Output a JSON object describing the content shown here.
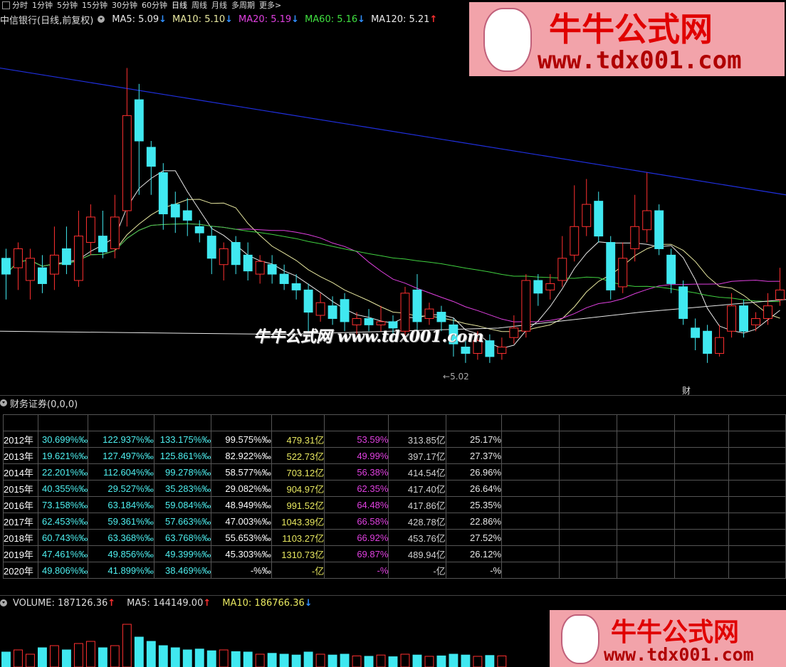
{
  "toolbar": {
    "tabs": [
      "分时",
      "1分钟",
      "5分钟",
      "15分钟",
      "30分钟",
      "60分钟",
      "日线",
      "周线",
      "月线",
      "多周期",
      "更多>"
    ],
    "active": "日线"
  },
  "header": {
    "title": "中信银行(日线,前复权)",
    "ma": [
      {
        "label": "MA5: 5.09",
        "dir": "down",
        "color": "#e8e8e8"
      },
      {
        "label": "MA10: 5.10",
        "dir": "down",
        "color": "#e8e8a0"
      },
      {
        "label": "MA20: 5.19",
        "dir": "down",
        "color": "#e040e0"
      },
      {
        "label": "MA60: 5.16",
        "dir": "down",
        "color": "#40e040"
      },
      {
        "label": "MA120: 5.21",
        "dir": "up",
        "color": "#e8e8e8"
      }
    ]
  },
  "chart_data": {
    "type": "candlestick",
    "candles": [
      {
        "o": 5.35,
        "c": 5.3,
        "h": 5.38,
        "l": 5.22
      },
      {
        "o": 5.32,
        "c": 5.38,
        "h": 5.4,
        "l": 5.25
      },
      {
        "o": 5.28,
        "c": 5.35,
        "h": 5.38,
        "l": 5.22
      },
      {
        "o": 5.32,
        "c": 5.27,
        "h": 5.36,
        "l": 5.24
      },
      {
        "o": 5.3,
        "c": 5.36,
        "h": 5.45,
        "l": 5.25
      },
      {
        "o": 5.38,
        "c": 5.33,
        "h": 5.45,
        "l": 5.3
      },
      {
        "o": 5.28,
        "c": 5.42,
        "h": 5.5,
        "l": 5.26
      },
      {
        "o": 5.4,
        "c": 5.48,
        "h": 5.52,
        "l": 5.36
      },
      {
        "o": 5.42,
        "c": 5.37,
        "h": 5.5,
        "l": 5.35
      },
      {
        "o": 5.38,
        "c": 5.48,
        "h": 5.55,
        "l": 5.35
      },
      {
        "o": 5.5,
        "c": 5.8,
        "h": 5.95,
        "l": 5.45
      },
      {
        "o": 5.85,
        "c": 5.72,
        "h": 5.9,
        "l": 5.55
      },
      {
        "o": 5.7,
        "c": 5.64,
        "h": 5.72,
        "l": 5.55
      },
      {
        "o": 5.62,
        "c": 5.49,
        "h": 5.65,
        "l": 5.44
      },
      {
        "o": 5.52,
        "c": 5.48,
        "h": 5.56,
        "l": 5.43
      },
      {
        "o": 5.5,
        "c": 5.47,
        "h": 5.54,
        "l": 5.42
      },
      {
        "o": 5.45,
        "c": 5.43,
        "h": 5.47,
        "l": 5.4
      },
      {
        "o": 5.42,
        "c": 5.35,
        "h": 5.45,
        "l": 5.3
      },
      {
        "o": 5.33,
        "c": 5.38,
        "h": 5.4,
        "l": 5.28
      },
      {
        "o": 5.4,
        "c": 5.33,
        "h": 5.42,
        "l": 5.3
      },
      {
        "o": 5.36,
        "c": 5.31,
        "h": 5.4,
        "l": 5.28
      },
      {
        "o": 5.3,
        "c": 5.34,
        "h": 5.36,
        "l": 5.27
      },
      {
        "o": 5.33,
        "c": 5.3,
        "h": 5.36,
        "l": 5.27
      },
      {
        "o": 5.3,
        "c": 5.27,
        "h": 5.33,
        "l": 5.25
      },
      {
        "o": 5.27,
        "c": 5.25,
        "h": 5.3,
        "l": 5.22
      },
      {
        "o": 5.25,
        "c": 5.18,
        "h": 5.27,
        "l": 5.12
      },
      {
        "o": 5.17,
        "c": 5.21,
        "h": 5.24,
        "l": 5.15
      },
      {
        "o": 5.2,
        "c": 5.16,
        "h": 5.23,
        "l": 5.14
      },
      {
        "o": 5.22,
        "c": 5.15,
        "h": 5.24,
        "l": 5.12
      },
      {
        "o": 5.14,
        "c": 5.16,
        "h": 5.18,
        "l": 5.11
      },
      {
        "o": 5.16,
        "c": 5.14,
        "h": 5.19,
        "l": 5.12
      },
      {
        "o": 5.14,
        "c": 5.15,
        "h": 5.2,
        "l": 5.12
      },
      {
        "o": 5.15,
        "c": 5.13,
        "h": 5.17,
        "l": 5.1
      },
      {
        "o": 5.12,
        "c": 5.24,
        "h": 5.26,
        "l": 5.1
      },
      {
        "o": 5.25,
        "c": 5.15,
        "h": 5.3,
        "l": 5.12
      },
      {
        "o": 5.16,
        "c": 5.19,
        "h": 5.21,
        "l": 5.14
      },
      {
        "o": 5.18,
        "c": 5.15,
        "h": 5.2,
        "l": 5.12
      },
      {
        "o": 5.14,
        "c": 5.08,
        "h": 5.16,
        "l": 5.04
      },
      {
        "o": 5.07,
        "c": 5.05,
        "h": 5.1,
        "l": 5.02
      },
      {
        "o": 5.05,
        "c": 5.09,
        "h": 5.12,
        "l": 5.03
      },
      {
        "o": 5.09,
        "c": 5.04,
        "h": 5.11,
        "l": 5.02
      },
      {
        "o": 5.05,
        "c": 5.07,
        "h": 5.1,
        "l": 5.03
      },
      {
        "o": 5.1,
        "c": 5.13,
        "h": 5.17,
        "l": 5.08
      },
      {
        "o": 5.12,
        "c": 5.28,
        "h": 5.3,
        "l": 5.1
      },
      {
        "o": 5.28,
        "c": 5.24,
        "h": 5.3,
        "l": 5.2
      },
      {
        "o": 5.25,
        "c": 5.27,
        "h": 5.3,
        "l": 5.22
      },
      {
        "o": 5.28,
        "c": 5.35,
        "h": 5.42,
        "l": 5.26
      },
      {
        "o": 5.36,
        "c": 5.45,
        "h": 5.58,
        "l": 5.34
      },
      {
        "o": 5.45,
        "c": 5.52,
        "h": 5.6,
        "l": 5.42
      },
      {
        "o": 5.53,
        "c": 5.42,
        "h": 5.56,
        "l": 5.4
      },
      {
        "o": 5.4,
        "c": 5.25,
        "h": 5.42,
        "l": 5.22
      },
      {
        "o": 5.26,
        "c": 5.35,
        "h": 5.4,
        "l": 5.24
      },
      {
        "o": 5.38,
        "c": 5.45,
        "h": 5.55,
        "l": 5.34
      },
      {
        "o": 5.44,
        "c": 5.5,
        "h": 5.62,
        "l": 5.4
      },
      {
        "o": 5.5,
        "c": 5.38,
        "h": 5.52,
        "l": 5.36
      },
      {
        "o": 5.36,
        "c": 5.27,
        "h": 5.38,
        "l": 5.24
      },
      {
        "o": 5.26,
        "c": 5.16,
        "h": 5.28,
        "l": 5.14
      },
      {
        "o": 5.13,
        "c": 5.1,
        "h": 5.16,
        "l": 5.06
      },
      {
        "o": 5.12,
        "c": 5.05,
        "h": 5.14,
        "l": 5.02
      },
      {
        "o": 5.05,
        "c": 5.1,
        "h": 5.14,
        "l": 5.04
      },
      {
        "o": 5.12,
        "c": 5.2,
        "h": 5.24,
        "l": 5.1
      },
      {
        "o": 5.2,
        "c": 5.12,
        "h": 5.22,
        "l": 5.1
      },
      {
        "o": 5.14,
        "c": 5.16,
        "h": 5.18,
        "l": 5.12
      },
      {
        "o": 5.16,
        "c": 5.2,
        "h": 5.24,
        "l": 5.14
      },
      {
        "o": 5.22,
        "c": 5.25,
        "h": 5.32,
        "l": 5.2
      }
    ],
    "low_label": "5.02",
    "event_label": "财"
  },
  "fin": {
    "title": "财务证券(0,0,0)",
    "rows": [
      [
        "2012年",
        "30.699%‰",
        "122.937%‰",
        "133.175%‰",
        "99.575%‰",
        "479.31亿",
        "53.59%",
        "313.85亿",
        "25.17%"
      ],
      [
        "2013年",
        "19.621%‰",
        "127.497%‰",
        "125.861%‰",
        "82.922%‰",
        "522.73亿",
        "49.99%",
        "397.17亿",
        "27.37%"
      ],
      [
        "2014年",
        "22.201%‰",
        "112.604%‰",
        "99.278%‰",
        "58.577%‰",
        "703.12亿",
        "56.38%",
        "414.54亿",
        "26.96%"
      ],
      [
        "2015年",
        "40.355%‰",
        "29.527%‰",
        "35.283%‰",
        "29.082%‰",
        "904.97亿",
        "62.35%",
        "417.40亿",
        "26.64%"
      ],
      [
        "2016年",
        "73.158%‰",
        "63.184%‰",
        "59.084%‰",
        "48.949%‰",
        "991.52亿",
        "64.48%",
        "417.86亿",
        "25.35%"
      ],
      [
        "2017年",
        "62.453%‰",
        "59.361%‰",
        "57.663%‰",
        "47.003%‰",
        "1043.39亿",
        "66.58%",
        "428.78亿",
        "22.86%"
      ],
      [
        "2018年",
        "60.743%‰",
        "63.368%‰",
        "63.768%‰",
        "55.653%‰",
        "1103.27亿",
        "66.92%",
        "453.76亿",
        "27.52%"
      ],
      [
        "2019年",
        "47.461%‰",
        "49.856%‰",
        "49.399%‰",
        "45.303%‰",
        "1310.73亿",
        "69.87%",
        "489.94亿",
        "26.12%"
      ],
      [
        "2020年",
        "49.806%‰",
        "41.899%‰",
        "38.469%‰",
        "-%‰",
        "-亿",
        "-%",
        "-亿",
        "-%"
      ]
    ],
    "colors": [
      "#ffffff",
      "#4ef0f0",
      "#4ef0f0",
      "#4ef0f0",
      "#ffffff",
      "#e8e860",
      "#e040e0",
      "#d0d0d0",
      "#e8e8e8"
    ]
  },
  "volume": {
    "label": "VOLUME: 187126.36",
    "ma5": "MA5: 144149.00",
    "ma10": "MA10: 186766.36",
    "bars": [
      0.35,
      0.4,
      0.3,
      0.45,
      0.5,
      0.4,
      0.55,
      0.6,
      0.45,
      0.5,
      1.0,
      0.7,
      0.6,
      0.5,
      0.45,
      0.4,
      0.42,
      0.38,
      0.4,
      0.36,
      0.35,
      0.3,
      0.32,
      0.3,
      0.28,
      0.35,
      0.3,
      0.28,
      0.3,
      0.26,
      0.25,
      0.28,
      0.24,
      0.3,
      0.28,
      0.25,
      0.26,
      0.3,
      0.28,
      0.25,
      0.27,
      0.26
    ]
  },
  "watermarks": {
    "brand": "牛牛公式网",
    "url": "www.tdx001.com",
    "center": "牛牛公式网 www.tdx001.com"
  }
}
